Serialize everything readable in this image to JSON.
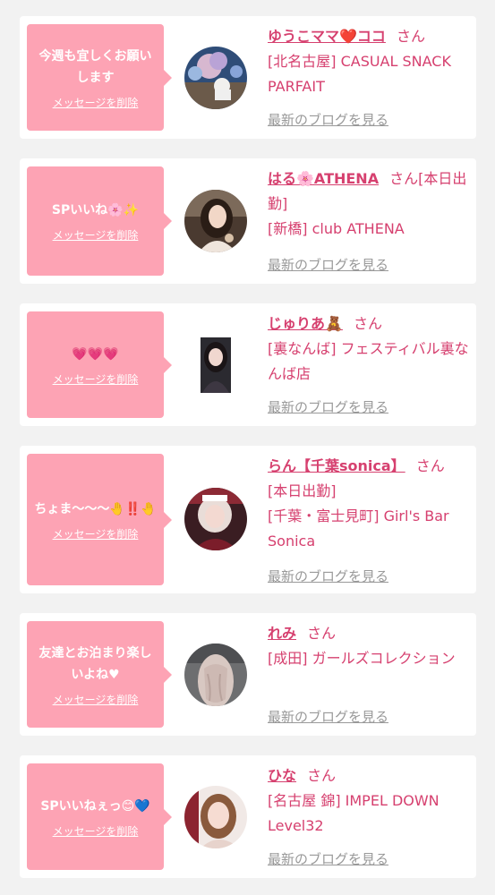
{
  "colors": {
    "page_bg": "#f2f2f2",
    "card_bg": "#ffffff",
    "bubble": "#fda3b4",
    "accent": "#d6406f",
    "muted": "#999999"
  },
  "entries": [
    {
      "message": "今週も宜しくお願いします",
      "delete_label": "メッセージを削除",
      "name": "ゆうこママ❤️ココ",
      "honorific": "さん",
      "shop": "[北名古屋] CASUAL SNACK PARFAIT",
      "blog_label": "最新のブログを見る",
      "avatar": "round-photo"
    },
    {
      "message": "SPいいね🌸✨",
      "delete_label": "メッセージを削除",
      "name": "はる🌸ATHENA",
      "honorific": "さん[本日出勤]",
      "shop": "[新橋] club ATHENA",
      "blog_label": "最新のブログを見る",
      "avatar": "round-photo"
    },
    {
      "message": "💗💗💗",
      "delete_label": "メッセージを削除",
      "name": "じゅりあ🧸",
      "honorific": "さん",
      "shop": "[裏なんば] フェスティバル裏なんば店",
      "blog_label": "最新のブログを見る",
      "avatar": "portrait-photo"
    },
    {
      "message": "ちょま〜〜〜🤚‼️🤚",
      "delete_label": "メッセージを削除",
      "name": "らん【千葉sonica】",
      "honorific": "さん",
      "shop": "[本日出勤]\n[千葉・富士見町] Girl's Bar Sonica",
      "blog_label": "最新のブログを見る",
      "avatar": "round-photo"
    },
    {
      "message": "友達とお泊まり楽しいよね♥",
      "delete_label": "メッセージを削除",
      "name": "れみ",
      "honorific": "さん",
      "shop": "[成田] ガールズコレクション",
      "blog_label": "最新のブログを見る",
      "avatar": "round-photo"
    },
    {
      "message": "SPいいねぇっ😊💙",
      "delete_label": "メッセージを削除",
      "name": "ひな",
      "honorific": "さん",
      "shop": "[名古屋 錦] IMPEL DOWN Level32",
      "blog_label": "最新のブログを見る",
      "avatar": "round-photo"
    }
  ]
}
